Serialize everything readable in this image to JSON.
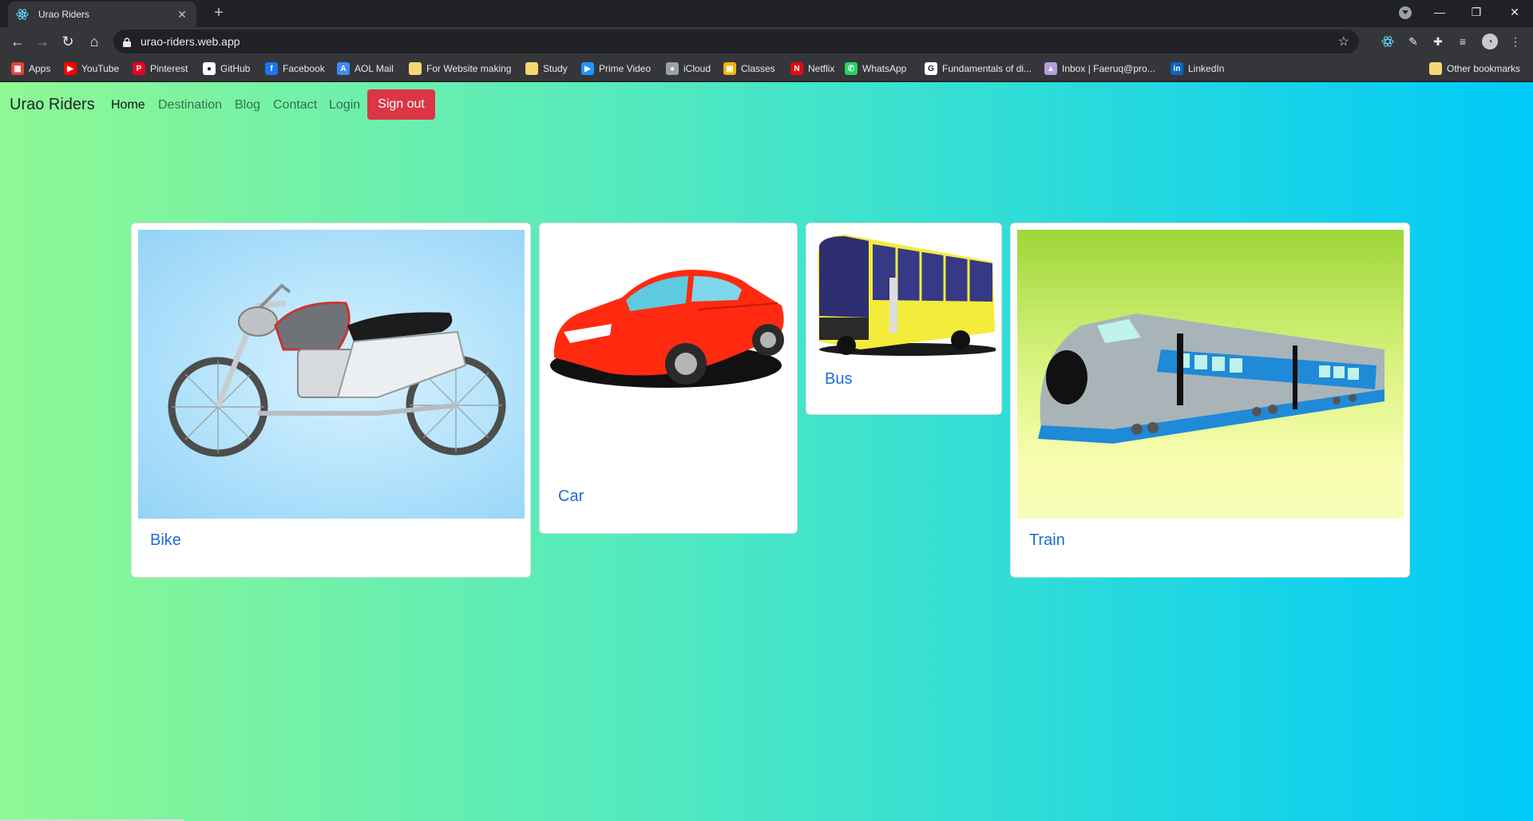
{
  "browser": {
    "tab_title": "Urao Riders",
    "url": "urao-riders.web.app",
    "bookmarks": [
      {
        "label": "Apps",
        "icon": "apps-grid-icon",
        "color": "#ea4335"
      },
      {
        "label": "YouTube",
        "icon": "youtube-icon",
        "color": "#ff0000"
      },
      {
        "label": "Pinterest",
        "icon": "pinterest-icon",
        "color": "#e60023"
      },
      {
        "label": "GitHub",
        "icon": "github-icon",
        "color": "#ffffff"
      },
      {
        "label": "Facebook",
        "icon": "facebook-icon",
        "color": "#1877f2"
      },
      {
        "label": "AOL Mail",
        "icon": "aol-mail-icon",
        "color": "#3d8af7"
      },
      {
        "label": "For Website making",
        "icon": "folder-icon",
        "color": "#f7d774"
      },
      {
        "label": "Study",
        "icon": "folder-icon",
        "color": "#f7d774"
      },
      {
        "label": "Prime Video",
        "icon": "prime-video-icon",
        "color": "#1a98ff"
      },
      {
        "label": "iCloud",
        "icon": "apple-icon",
        "color": "#9aa0a6"
      },
      {
        "label": "Classes",
        "icon": "classroom-icon",
        "color": "#f4b400"
      },
      {
        "label": "Netflix",
        "icon": "netflix-icon",
        "color": "#e50914"
      },
      {
        "label": "WhatsApp",
        "icon": "whatsapp-icon",
        "color": "#25d366"
      },
      {
        "label": "Fundamentals of di...",
        "icon": "google-icon",
        "color": "#ffffff"
      },
      {
        "label": "Inbox | Faeruq@pro...",
        "icon": "lock-icon",
        "color": "#b39ddb"
      },
      {
        "label": "LinkedIn",
        "icon": "linkedin-icon",
        "color": "#0a66c2"
      }
    ],
    "other_bookmarks": "Other bookmarks"
  },
  "site": {
    "brand": "Urao Riders",
    "nav": [
      {
        "label": "Home",
        "active": true
      },
      {
        "label": "Destination",
        "active": false
      },
      {
        "label": "Blog",
        "active": false
      },
      {
        "label": "Contact",
        "active": false
      },
      {
        "label": "Login",
        "active": false
      }
    ],
    "signout_label": "Sign out",
    "cards": [
      {
        "label": "Bike",
        "icon": "motorcycle-image"
      },
      {
        "label": "Car",
        "icon": "car-image"
      },
      {
        "label": "Bus",
        "icon": "bus-image"
      },
      {
        "label": "Train",
        "icon": "train-image"
      }
    ]
  },
  "colors": {
    "gradient_start": "#8ff893",
    "gradient_end": "#00caf8",
    "signout": "#dc3545",
    "card_label": "#1a6fd6"
  }
}
